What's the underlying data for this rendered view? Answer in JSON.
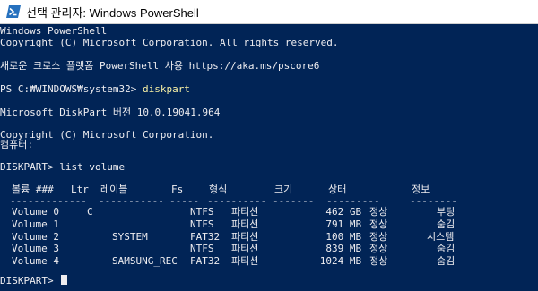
{
  "window": {
    "title": "선택 관리자: Windows PowerShell",
    "icon": "powershell-icon"
  },
  "console": {
    "banner": "Windows PowerShell",
    "copyright": "Copyright (C) Microsoft Corporation. All rights reserved.",
    "promo": "새로운 크로스 플랫폼 PowerShell 사용 https://aka.ms/pscore6",
    "prompt1": "PS C:₩WINDOWS₩system32> ",
    "command1": "diskpart",
    "dp_version": "Microsoft DiskPart 버전 10.0.19041.964",
    "dp_copyright": "Copyright (C) Microsoft Corporation.",
    "computer_label": "컴퓨터:",
    "prompt2": "DISKPART> ",
    "command2": "list volume",
    "headers": [
      "볼륨 ###",
      "Ltr",
      "레이블",
      "Fs",
      "형식",
      "크기",
      "상태",
      "정보"
    ],
    "separators": [
      "----------",
      "---",
      "-----------",
      "-----",
      "----------",
      "-------",
      "---------",
      "--------"
    ],
    "volumes": [
      {
        "name": "Volume 0",
        "ltr": "C",
        "label": "",
        "fs": "NTFS",
        "type": "파티션",
        "size": "462 GB",
        "status": "정상",
        "info": "부팅"
      },
      {
        "name": "Volume 1",
        "ltr": "",
        "label": "",
        "fs": "NTFS",
        "type": "파티션",
        "size": "791 MB",
        "status": "정상",
        "info": "숨김"
      },
      {
        "name": "Volume 2",
        "ltr": "",
        "label": "SYSTEM",
        "fs": "FAT32",
        "type": "파티션",
        "size": "100 MB",
        "status": "정상",
        "info": "시스템"
      },
      {
        "name": "Volume 3",
        "ltr": "",
        "label": "",
        "fs": "NTFS",
        "type": "파티션",
        "size": "839 MB",
        "status": "정상",
        "info": "숨김"
      },
      {
        "name": "Volume 4",
        "ltr": "",
        "label": "SAMSUNG_REC",
        "fs": "FAT32",
        "type": "파티션",
        "size": "1024 MB",
        "status": "정상",
        "info": "숨김"
      }
    ],
    "prompt3": "DISKPART> "
  },
  "colors": {
    "background": "#012456",
    "text": "#eeedf0",
    "command": "#f9f1a5"
  }
}
